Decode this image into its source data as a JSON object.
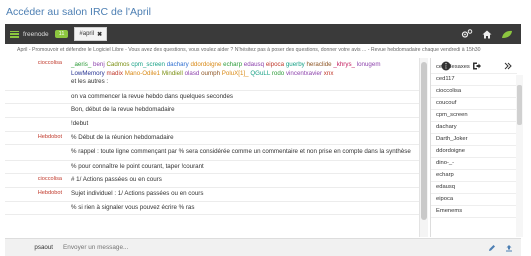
{
  "page": {
    "title": "Accéder au salon IRC de l'April"
  },
  "topbar": {
    "network": "freenode",
    "network_badge": "11",
    "channel_tab": "#april",
    "channel_close": "✖",
    "icons": [
      "settings-icon",
      "home-icon",
      "leaf-icon"
    ]
  },
  "topic": "April - Promouvoir et défendre le Logiciel Libre - Vous avez des questions, vous voulez aider ? N'hésitez pas à poser des questions, donner votre avis ... - Revue hebdomadaire chaque vendredi à 15h30",
  "nick_list_line": {
    "nick": "cioccolisa",
    "names": [
      {
        "t": "_aeris_",
        "c": "c-green"
      },
      {
        "t": "benj",
        "c": "c-purple"
      },
      {
        "t": "Cadmos",
        "c": "c-olive"
      },
      {
        "t": "cpm_screen",
        "c": "c-teal"
      },
      {
        "t": "dachary",
        "c": "c-blue"
      },
      {
        "t": "ddordoigne",
        "c": "c-orange"
      },
      {
        "t": "echarp",
        "c": "c-green"
      },
      {
        "t": "edausq",
        "c": "c-purple"
      },
      {
        "t": "eipoca",
        "c": "c-red"
      },
      {
        "t": "guerby",
        "c": "c-teal"
      },
      {
        "t": "heraclide",
        "c": "c-brown"
      },
      {
        "t": "_khrys_",
        "c": "c-pink"
      },
      {
        "t": "lonugem",
        "c": "c-purple"
      },
      {
        "t": "LowMemory",
        "c": "c-navy"
      },
      {
        "t": "madix",
        "c": "c-red"
      },
      {
        "t": "Mano-Odile1",
        "c": "c-orange"
      },
      {
        "t": "Mindiell",
        "c": "c-olive"
      },
      {
        "t": "olasd",
        "c": "c-purple"
      },
      {
        "t": "oumph",
        "c": "c-brown"
      },
      {
        "t": "PoluX[1]_",
        "c": "c-orange"
      },
      {
        "t": "QGuLL",
        "c": "c-teal"
      },
      {
        "t": "rodo",
        "c": "c-green"
      },
      {
        "t": "vincentxavier",
        "c": "c-purple"
      },
      {
        "t": "xnx",
        "c": "c-red"
      }
    ],
    "suffix": "et les autres :"
  },
  "messages": [
    {
      "nick": "",
      "text": "on va commencer la revue hebdo dans quelques secondes"
    },
    {
      "nick": "",
      "text": "Bon, début de la revue hebdomadaire"
    },
    {
      "nick": "",
      "text": "!debut"
    },
    {
      "nick": "Hebdobot",
      "text": "% Début de la réunion hebdomadaire"
    },
    {
      "nick": "",
      "text": "% rappel : toute ligne commençant par % sera considérée comme un commentaire et non prise en compte dans la synthèse"
    },
    {
      "nick": "",
      "text": "% pour connaître le point courant, taper !courant"
    },
    {
      "nick": "cioccolisa",
      "text": "# 1/ Actions passées ou en cours"
    },
    {
      "nick": "Hebdobot",
      "text": "Sujet individuel : 1/ Actions passées ou en cours"
    },
    {
      "nick": "",
      "text": "% si rien à signaler vous pouvez écrire % ras"
    }
  ],
  "users": [
    "cedkdesaxes",
    "ced117",
    "cioccolisa",
    "coucouf",
    "cpm_screen",
    "dachary",
    "Darth_Joker",
    "ddordoigne",
    "dino-_-",
    "echarp",
    "edausq",
    "eipoca",
    "Emenems"
  ],
  "input": {
    "nick": "psaout",
    "placeholder": "Envoyer un message..."
  }
}
